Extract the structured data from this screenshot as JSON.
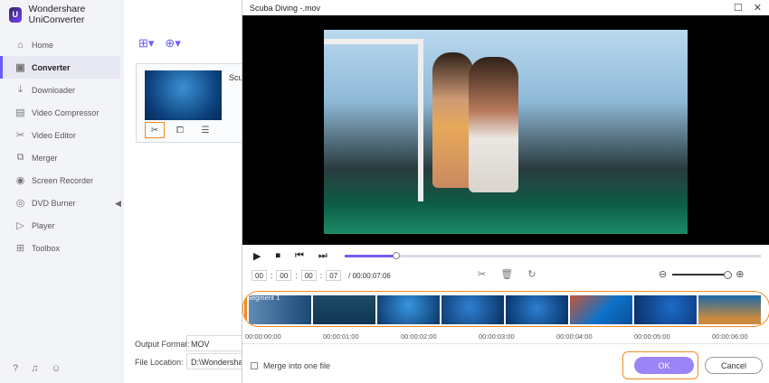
{
  "app": {
    "title": "Wondershare UniConverter",
    "logo_icon": "uniconverter-logo-icon"
  },
  "sidebar": {
    "items": [
      {
        "label": "Home",
        "icon": "home-icon",
        "active": false
      },
      {
        "label": "Converter",
        "icon": "converter-icon",
        "active": true
      },
      {
        "label": "Downloader",
        "icon": "download-icon",
        "active": false
      },
      {
        "label": "Video Compressor",
        "icon": "compress-icon",
        "active": false
      },
      {
        "label": "Video Editor",
        "icon": "scissors-icon",
        "active": false
      },
      {
        "label": "Merger",
        "icon": "merge-icon",
        "active": false
      },
      {
        "label": "Screen Recorder",
        "icon": "record-icon",
        "active": false
      },
      {
        "label": "DVD Burner",
        "icon": "disc-icon",
        "active": false
      },
      {
        "label": "Player",
        "icon": "play-icon",
        "active": false
      },
      {
        "label": "Toolbox",
        "icon": "grid-icon",
        "active": false
      }
    ],
    "bottom_icons": [
      "help-icon",
      "bell-icon",
      "feedback-icon"
    ]
  },
  "main": {
    "file_name": "Scu",
    "output_format_label": "Output Format:",
    "output_format_value": "MOV",
    "file_location_label": "File Location:",
    "file_location_value": "D:\\Wondershare"
  },
  "dialog": {
    "title": "Scuba Diving -.mov",
    "current_time": {
      "hh": "00",
      "mm": "00",
      "ss": "00",
      "ff": "07"
    },
    "total_time": "/ 00:00:07:06",
    "segment_label": "Segment 1",
    "ticks": [
      "00:00:00:00",
      "00:00:01:00",
      "00:00:02:00",
      "00:00:03:00",
      "00:00:04:00",
      "00:00:05:00",
      "00:00:06:00"
    ],
    "merge_label": "Merge into one file",
    "ok_label": "OK",
    "cancel_label": "Cancel",
    "accent": "#7a5cf0",
    "highlight": "#f08a24"
  }
}
